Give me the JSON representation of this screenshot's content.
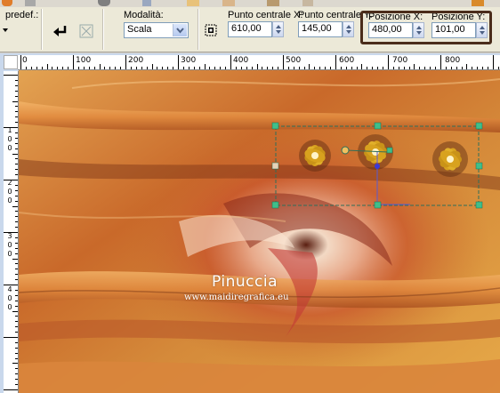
{
  "toolbar": {
    "preset_label": "predef.:",
    "mode_label": "Modalità:",
    "mode_value": "Scala",
    "center_x_label": "Punto centrale X:",
    "center_x_value": "610,00",
    "center_y_label": "Punto centrale Y:",
    "center_y_value": "145,00",
    "pos_x_label": "Posizione X:",
    "pos_x_value": "480,00",
    "pos_y_label": "Posizione Y:",
    "pos_y_value": "101,00"
  },
  "ruler": {
    "h_labels": [
      "0",
      "100",
      "200",
      "300",
      "400",
      "500",
      "600",
      "700",
      "800"
    ],
    "v_labels": [
      "1",
      "0",
      "0",
      "2",
      "0",
      "0",
      "3",
      "0",
      "0",
      "4",
      "0",
      "0"
    ]
  },
  "canvas": {
    "watermark_title": "Pinuccia",
    "watermark_url": "www.maidiregrafica.eu"
  },
  "colors": {
    "highlight_border": "#4a2c1a",
    "selection_handle": "#3fbf8a",
    "image_base": "#c8712d"
  }
}
